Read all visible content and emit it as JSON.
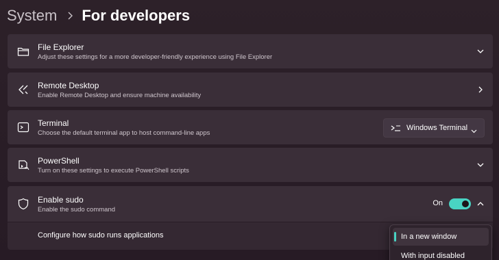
{
  "breadcrumb": {
    "parent": "System",
    "current": "For developers"
  },
  "cards": [
    {
      "title": "File Explorer",
      "description": "Adjust these settings for a more developer-friendly experience using File Explorer",
      "icon": "folder-icon",
      "action": "chevron-down"
    },
    {
      "title": "Remote Desktop",
      "description": "Enable Remote Desktop and ensure machine availability",
      "icon": "remote-desktop-icon",
      "action": "chevron-right"
    },
    {
      "title": "Terminal",
      "description": "Choose the default terminal app to host command-line apps",
      "icon": "terminal-icon",
      "action": "dropdown",
      "dropdown_value": "Windows Terminal"
    },
    {
      "title": "PowerShell",
      "description": "Turn on these settings to execute PowerShell scripts",
      "icon": "powershell-icon",
      "action": "chevron-down"
    },
    {
      "title": "Enable sudo",
      "description": "Enable the sudo command",
      "icon": "shield-icon",
      "action": "toggle",
      "toggle_state": "On",
      "expanded": true
    }
  ],
  "sudo_config": {
    "label": "Configure how sudo runs applications",
    "options": [
      "In a new window",
      "With input disabled"
    ],
    "selected": "In a new window"
  },
  "colors": {
    "accent": "#49d3c3",
    "card_bg": "#3a2e38",
    "page_bg": "#2a1e28"
  }
}
